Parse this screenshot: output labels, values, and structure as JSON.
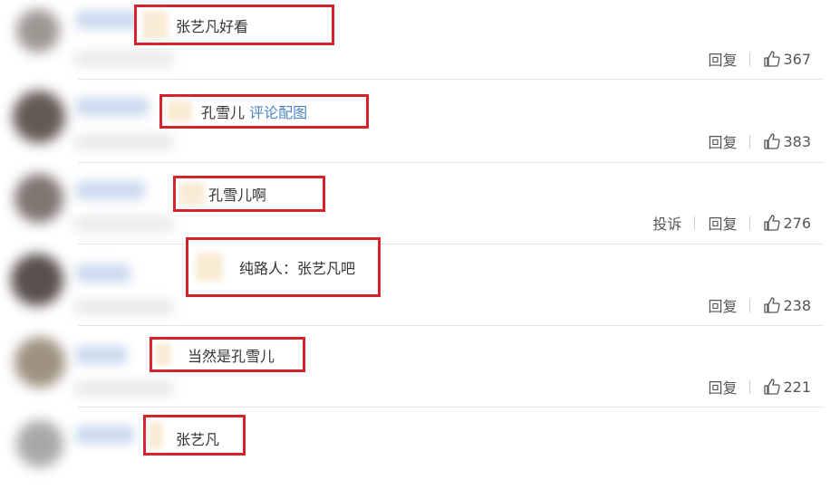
{
  "comments": [
    {
      "text": "张艺凡好看",
      "reply": "回复",
      "likes": "367"
    },
    {
      "text": "孔雪儿",
      "link": "评论配图",
      "reply": "回复",
      "likes": "383"
    },
    {
      "text": "孔雪儿啊",
      "report": "投诉",
      "reply": "回复",
      "likes": "276"
    },
    {
      "text": "纯路人：张艺凡吧",
      "reply": "回复",
      "likes": "238"
    },
    {
      "text": "当然是孔雪儿",
      "reply": "回复",
      "likes": "221"
    },
    {
      "text": "张艺凡"
    }
  ],
  "icons": {
    "like": "thumbs-up-icon"
  },
  "colors": {
    "highlight_box": "#d6222b",
    "link": "#4a86c2",
    "divider": "#e4e4e4"
  }
}
